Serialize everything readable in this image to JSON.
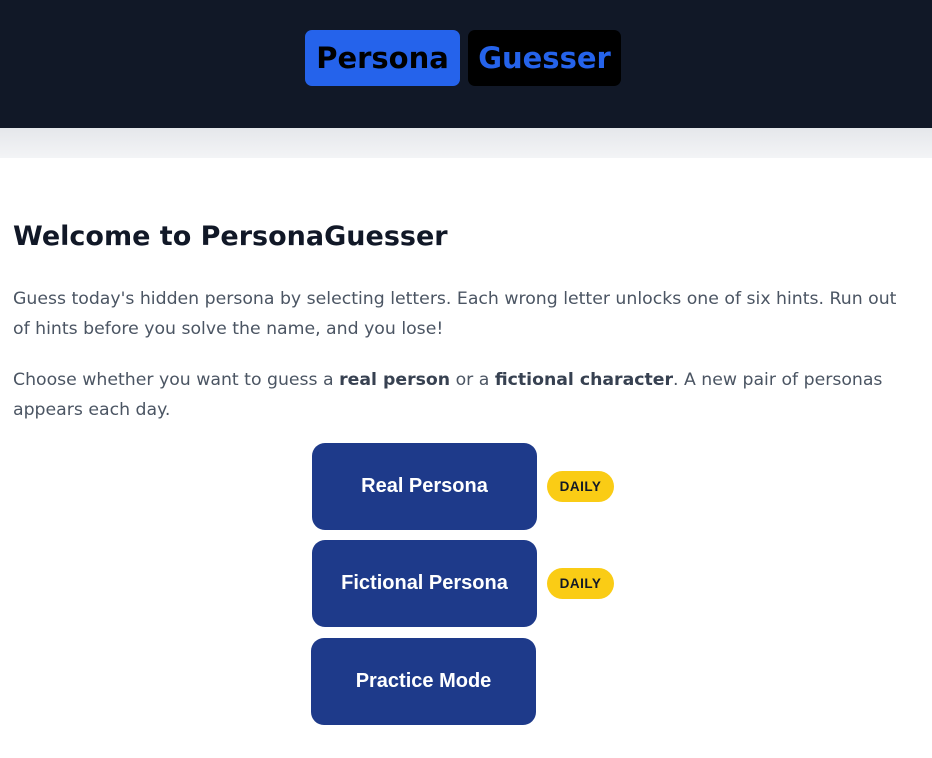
{
  "header": {
    "logo_part1": "Persona",
    "logo_part2": "Guesser",
    "colors": {
      "background": "#111827",
      "accent": "#2563eb"
    }
  },
  "main": {
    "title": "Welcome to PersonaGuesser",
    "intro": "Guess today's hidden persona by selecting letters. Each wrong letter unlocks one of six hints. Run out of hints before you solve the name, and you lose!",
    "choose": {
      "prefix": "Choose whether you want to guess a ",
      "bold1": "real person",
      "middle": " or a ",
      "bold2": "fictional character",
      "suffix": ". A new pair of personas appears each day."
    },
    "buttons": [
      {
        "label": "Real Persona",
        "badge": "DAILY"
      },
      {
        "label": "Fictional Persona",
        "badge": "DAILY"
      },
      {
        "label": "Practice Mode"
      }
    ],
    "colors": {
      "button": "#1e3a8a",
      "badge": "#facc15"
    }
  }
}
